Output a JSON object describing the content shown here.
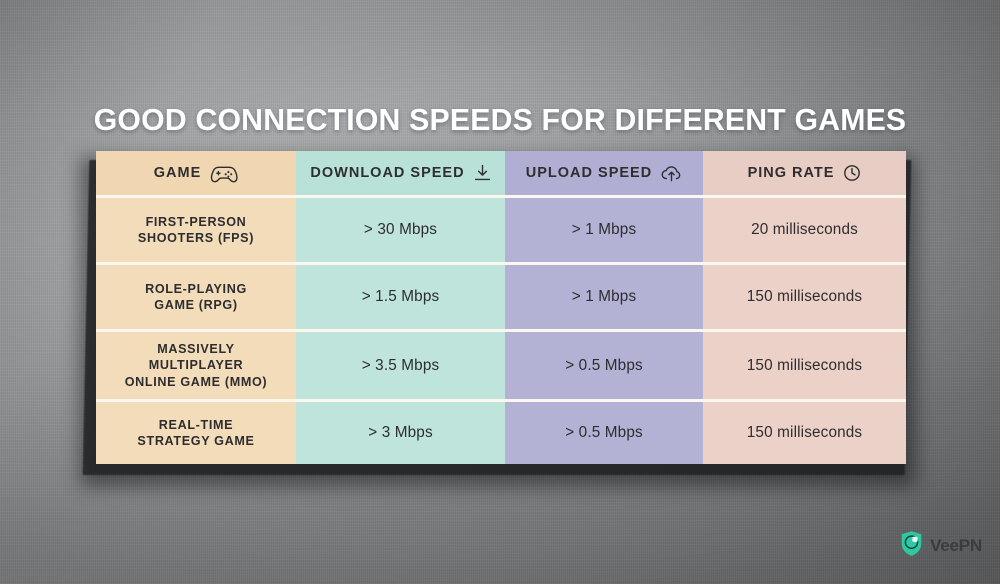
{
  "page": {
    "title": "GOOD CONNECTION SPEEDS FOR DIFFERENT GAMES",
    "background_color": "#8a8c8e"
  },
  "brand": {
    "name": "VeePN",
    "logo_icon": "shield-icon",
    "logo_color": "#2fc8a3"
  },
  "table": {
    "columns": [
      {
        "key": "game",
        "label": "GAME",
        "icon": "gamepad-icon",
        "color": "#f3dcba"
      },
      {
        "key": "download",
        "label": "DOWNLOAD SPEED",
        "icon": "download-icon",
        "color": "#bfe4dc"
      },
      {
        "key": "upload",
        "label": "UPLOAD SPEED",
        "icon": "cloud-upload-icon",
        "color": "#b3b2d5"
      },
      {
        "key": "ping",
        "label": "PING RATE",
        "icon": "clock-icon",
        "color": "#ecd1c8"
      }
    ],
    "rows": [
      {
        "game_line1": "FIRST-PERSON",
        "game_line2": "SHOOTERS (FPS)",
        "game_line3": "",
        "download": "> 30 Mbps",
        "upload": "> 1 Mbps",
        "ping": "20 milliseconds"
      },
      {
        "game_line1": "ROLE-PLAYING",
        "game_line2": "GAME (RPG)",
        "game_line3": "",
        "download": "> 1.5 Mbps",
        "upload": "> 1 Mbps",
        "ping": "150 milliseconds"
      },
      {
        "game_line1": "MASSIVELY",
        "game_line2": "MULTIPLAYER",
        "game_line3": "ONLINE GAME (MMO)",
        "download": "> 3.5 Mbps",
        "upload": "> 0.5 Mbps",
        "ping": "150 milliseconds"
      },
      {
        "game_line1": "REAL-TIME",
        "game_line2": "STRATEGY GAME",
        "game_line3": "",
        "download": "> 3 Mbps",
        "upload": "> 0.5 Mbps",
        "ping": "150 milliseconds"
      }
    ]
  }
}
